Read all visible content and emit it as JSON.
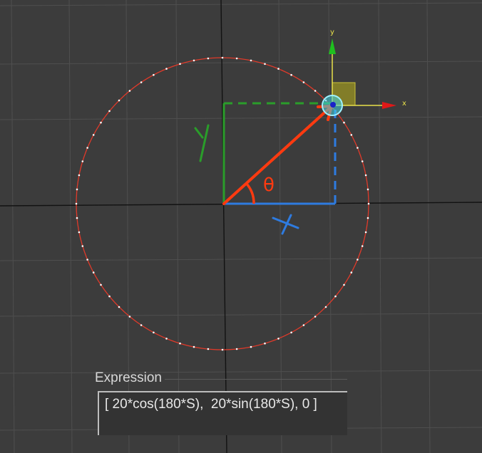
{
  "viewport": {
    "gizmo": {
      "axis_x_label": "x",
      "axis_y_label": "y"
    },
    "annotations": {
      "x_label": "X",
      "y_label": "Y",
      "theta_label": "θ"
    },
    "colors": {
      "background": "#3c3c3c",
      "grid": "#4f4f4f",
      "world_axis": "#111111",
      "circle": "#e03a2a",
      "vertex": "#ffffff",
      "radius_arrow": "#ff3a10",
      "x_component": "#2e7be0",
      "y_component": "#2a9d2a",
      "gizmo_x": "#e01818",
      "gizmo_y": "#1fbf1f",
      "gizmo_plane": "#8a8426",
      "gizmo_handle": "#3fd6e6"
    }
  },
  "expression_panel": {
    "title": "Expression",
    "value": "[ 20*cos(180*S),  20*sin(180*S), 0 ]"
  }
}
